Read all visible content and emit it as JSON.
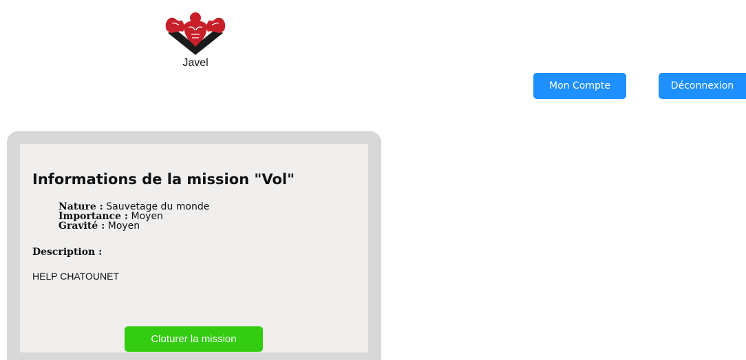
{
  "header": {
    "logo_text": "Javel",
    "account_label": "Mon Compte",
    "logout_label": "Déconnexion"
  },
  "mission": {
    "title": "Informations de la mission \"Vol\"",
    "fields": [
      {
        "label": "Nature :",
        "value": "Sauvetage du monde"
      },
      {
        "label": "Importance :",
        "value": "Moyen"
      },
      {
        "label": "Gravité :",
        "value": "Moyen"
      }
    ],
    "description_label": "Description :",
    "description_text": "HELP CHATOUNET",
    "close_label": "Cloturer la mission"
  },
  "colors": {
    "primary_button": "#1e90ff",
    "success_button": "#33cc11",
    "logo_red": "#c8202a"
  },
  "icons": {
    "logo": "muscle-man-diamond-logo"
  }
}
